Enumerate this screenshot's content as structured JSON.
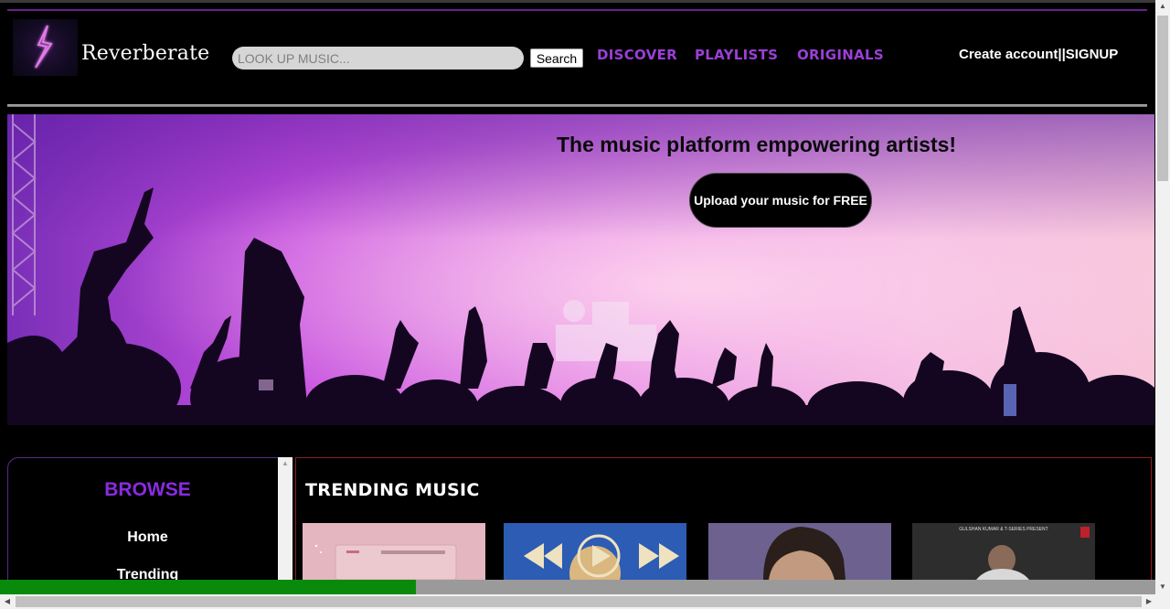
{
  "brand": {
    "name": "Reverberate",
    "logo_icon": "lightning-bolt-icon",
    "accent": "#8a2be2"
  },
  "search": {
    "placeholder": "LOOK UP MUSIC...",
    "button_label": "Search"
  },
  "nav": {
    "links": [
      "DISCOVER",
      "PLAYLISTS",
      "ORIGINALS"
    ],
    "account_label": "Create account||SIGNUP"
  },
  "hero": {
    "title": "The music platform empowering artists!",
    "cta_label": "Upload your music for FREE"
  },
  "browse": {
    "title": "BROWSE",
    "items": [
      "Home",
      "Trending"
    ]
  },
  "trending": {
    "title": "TRENDING MUSIC",
    "cards": [
      {
        "caption": ""
      },
      {
        "caption": ""
      },
      {
        "caption": ""
      },
      {
        "caption": "GULSHAN KUMAR & T-SERIES PRESENT"
      }
    ]
  },
  "progress": {
    "fraction": 0.36,
    "color": "#0a8a0a"
  },
  "colors": {
    "nav_link": "#9b3fd8",
    "divider": "#6b1f8e",
    "trending_border": "#8a1e1e"
  }
}
